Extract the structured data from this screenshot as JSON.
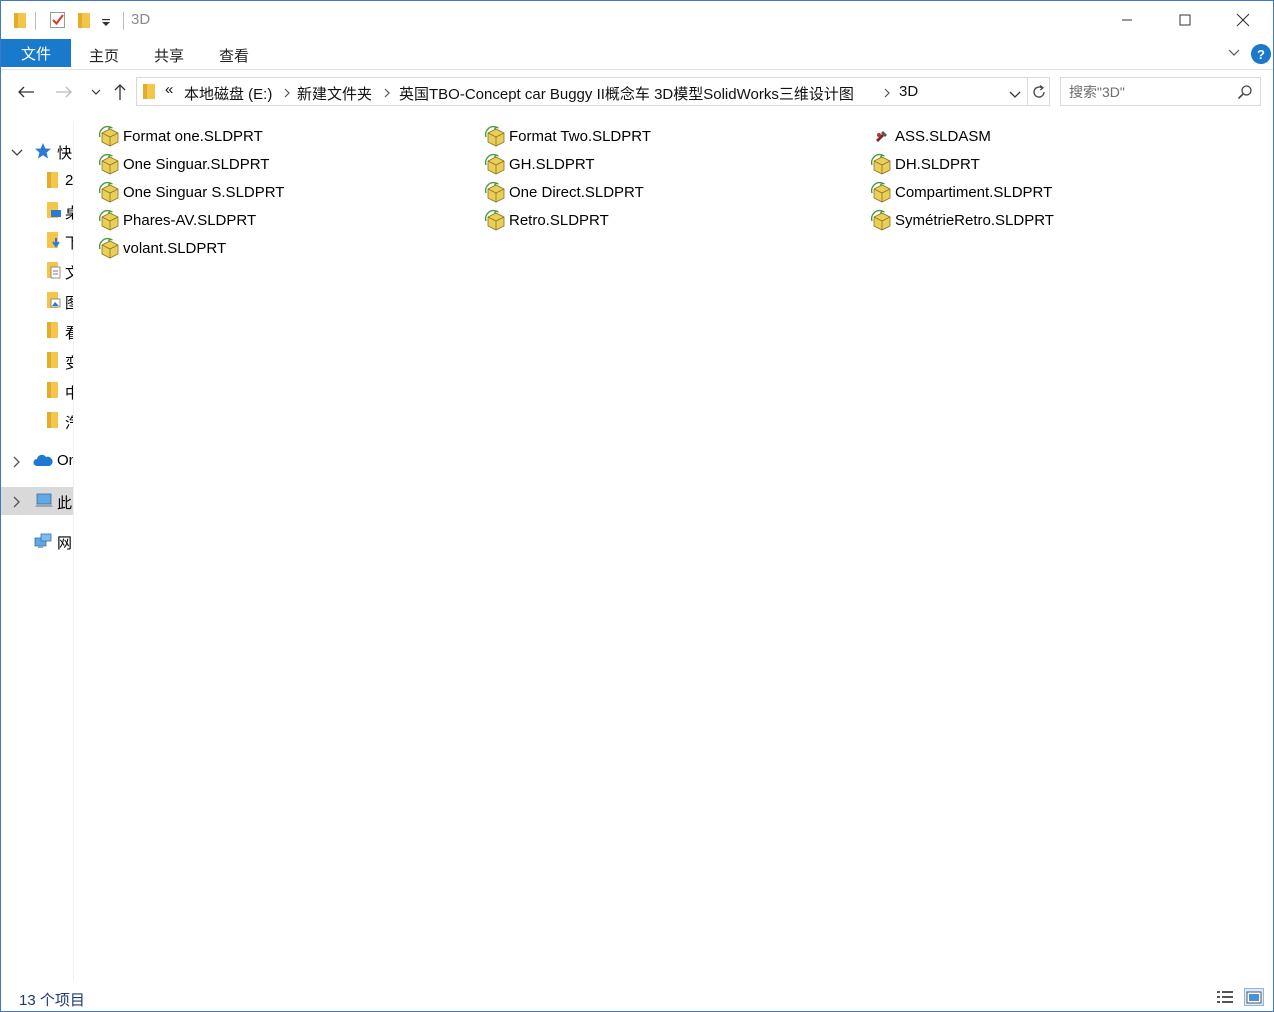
{
  "window": {
    "title": "3D"
  },
  "ribbon": {
    "tabs": [
      "文件",
      "主页",
      "共享",
      "查看"
    ],
    "help": "?"
  },
  "address": {
    "overflow": "«",
    "crumbs": [
      "本地磁盘 (E:)",
      "新建文件夹",
      "英国TBO-Concept car Buggy II概念车 3D模型SolidWorks三维设计图",
      "3D"
    ]
  },
  "search": {
    "placeholder": "搜索\"3D\""
  },
  "sidebar": {
    "items": [
      {
        "label": "快",
        "icon": "star-icon"
      },
      {
        "label": "2",
        "icon": "folder-icon"
      },
      {
        "label": "桌",
        "icon": "desktop-folder-icon"
      },
      {
        "label": "下",
        "icon": "download-folder-icon"
      },
      {
        "label": "文",
        "icon": "documents-folder-icon"
      },
      {
        "label": "图",
        "icon": "pictures-folder-icon"
      },
      {
        "label": "看",
        "icon": "folder-icon"
      },
      {
        "label": "变",
        "icon": "folder-icon"
      },
      {
        "label": "中",
        "icon": "folder-icon"
      },
      {
        "label": "汽",
        "icon": "folder-icon"
      },
      {
        "label": "On",
        "icon": "onedrive-icon"
      },
      {
        "label": "此",
        "icon": "this-pc-icon"
      },
      {
        "label": "网",
        "icon": "network-icon"
      }
    ]
  },
  "files": {
    "col1": [
      "Format one.SLDPRT",
      "One Singuar.SLDPRT",
      "One Singuar S.SLDPRT",
      "Phares-AV.SLDPRT",
      "volant.SLDPRT"
    ],
    "col2": [
      "Format Two.SLDPRT",
      "GH.SLDPRT",
      "One Direct.SLDPRT",
      "Retro.SLDPRT"
    ],
    "col3": [
      "ASS.SLDASM",
      "DH.SLDPRT",
      "Compartiment.SLDPRT",
      "SymétrieRetro.SLDPRT"
    ]
  },
  "status": {
    "item_count": "13 个项目"
  },
  "colors": {
    "accent": "#1979ca",
    "folder": "#f3c64b",
    "part_icon": "#c9a63a"
  }
}
